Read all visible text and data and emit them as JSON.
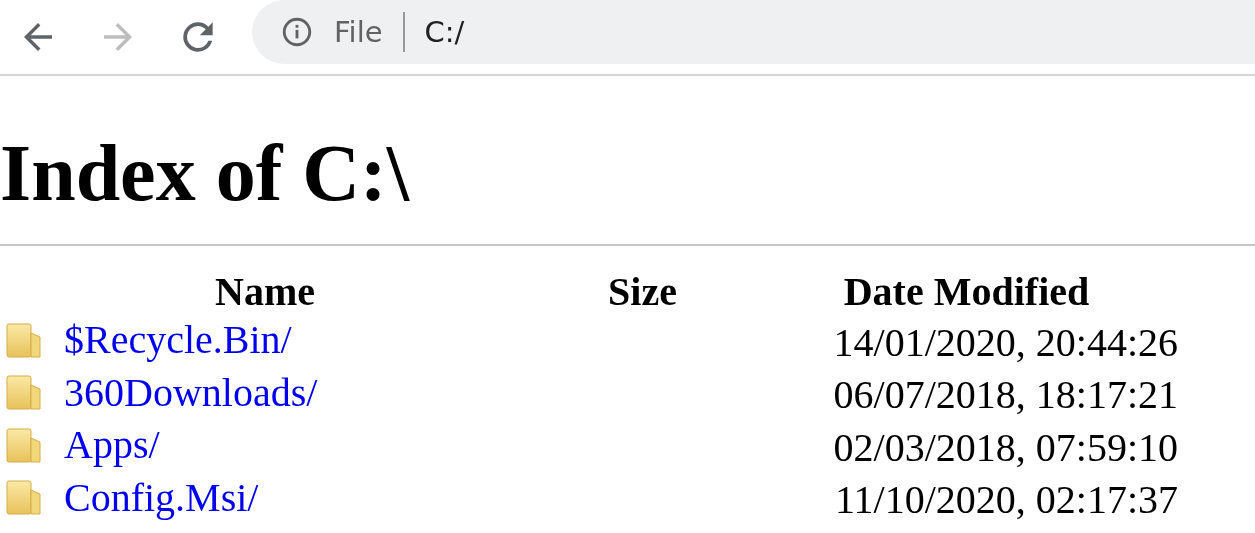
{
  "toolbar": {
    "nav": [
      {
        "kind": "back",
        "disabled": false
      },
      {
        "kind": "forward",
        "disabled": true
      },
      {
        "kind": "reload",
        "disabled": false
      }
    ],
    "address": {
      "scheme": "File",
      "url": "C:/"
    }
  },
  "heading": "Index of C:\\",
  "table": {
    "columns": [
      "Name",
      "Size",
      "Date Modified"
    ],
    "rows": [
      {
        "name": "$Recycle.Bin/",
        "size": "",
        "date": "14/01/2020, 20:44:26"
      },
      {
        "name": "360Downloads/",
        "size": "",
        "date": "06/07/2018, 18:17:21"
      },
      {
        "name": "Apps/",
        "size": "",
        "date": "02/03/2018, 07:59:10"
      },
      {
        "name": "Config.Msi/",
        "size": "",
        "date": "11/10/2020, 02:17:37"
      }
    ]
  }
}
